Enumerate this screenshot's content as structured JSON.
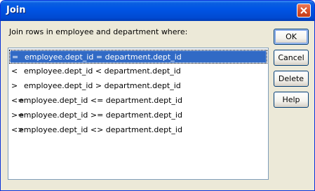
{
  "window": {
    "title": "Join"
  },
  "prompt": "Join rows in employee and department where:",
  "join_options": [
    {
      "op": "=",
      "expr": "employee.dept_id = department.dept_id",
      "selected": true
    },
    {
      "op": "<",
      "expr": "employee.dept_id < department.dept_id",
      "selected": false
    },
    {
      "op": ">",
      "expr": "employee.dept_id > department.dept_id",
      "selected": false
    },
    {
      "op": "<=",
      "expr": "employee.dept_id <= department.dept_id",
      "selected": false
    },
    {
      "op": ">=",
      "expr": "employee.dept_id >= department.dept_id",
      "selected": false
    },
    {
      "op": "<>",
      "expr": "employee.dept_id <> department.dept_id",
      "selected": false
    }
  ],
  "buttons": {
    "ok": "OK",
    "cancel": "Cancel",
    "delete": "Delete",
    "help": "Help"
  },
  "colors": {
    "selection": "#316ac5",
    "titlebar": "#0055e5",
    "close_button": "#d9532e",
    "dialog_bg": "#ece9d8"
  },
  "icons": {
    "close": "close-icon"
  }
}
